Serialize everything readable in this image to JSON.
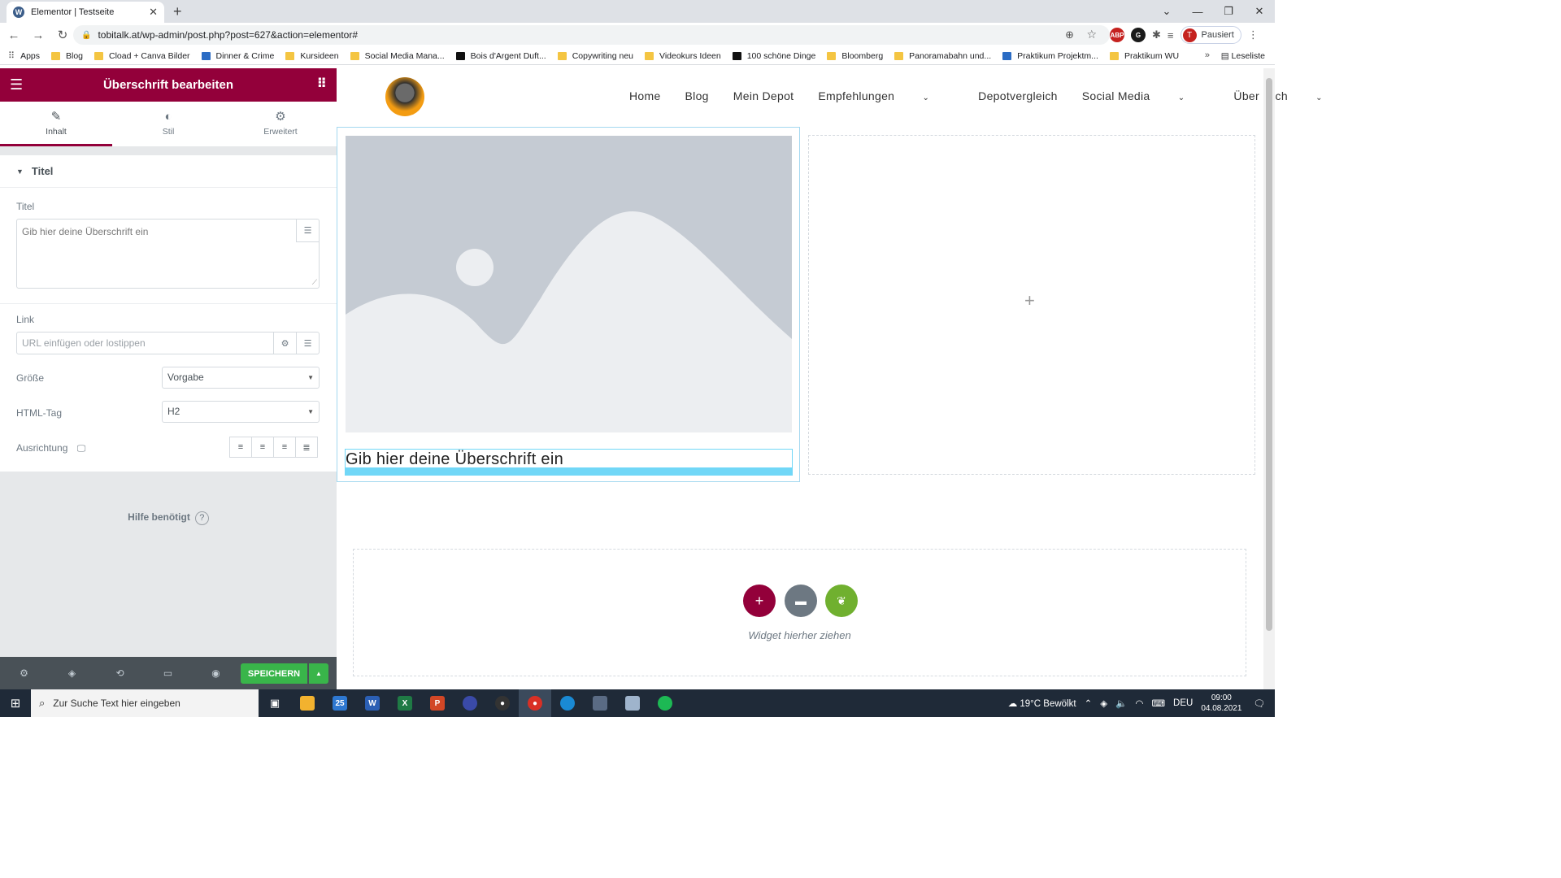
{
  "browser": {
    "tab_title": "Elementor | Testseite",
    "url": "tobitalk.at/wp-admin/post.php?post=627&action=elementor#",
    "profile_label": "Pausiert",
    "profile_initial": "T",
    "reading_list": "Leseliste",
    "bookmarks": [
      "Apps",
      "Blog",
      "Cload + Canva Bilder",
      "Dinner & Crime",
      "Kursideen",
      "Social Media Mana...",
      "Bois d'Argent Duft...",
      "Copywriting neu",
      "Videokurs Ideen",
      "100 schöne Dinge",
      "Bloomberg",
      "Panoramabahn und...",
      "Praktikum Projektm...",
      "Praktikum WU"
    ]
  },
  "panel": {
    "header_title": "Überschrift bearbeiten",
    "tabs": [
      "Inhalt",
      "Stil",
      "Erweitert"
    ],
    "section_title": "Titel",
    "title_label": "Titel",
    "title_placeholder": "Gib hier deine Überschrift ein",
    "link_label": "Link",
    "link_placeholder": "URL einfügen oder lostippen",
    "size_label": "Größe",
    "size_value": "Vorgabe",
    "html_tag_label": "HTML-Tag",
    "html_tag_value": "H2",
    "alignment_label": "Ausrichtung",
    "help_text": "Hilfe benötigt",
    "save_label": "SPEICHERN"
  },
  "site": {
    "nav": [
      "Home",
      "Blog",
      "Mein Depot",
      "Empfehlungen",
      "Depotvergleich",
      "Social Media",
      "Über mich"
    ],
    "heading_text": "Gib hier deine Überschrift ein",
    "drop_hint": "Widget hierher ziehen"
  },
  "taskbar": {
    "search_placeholder": "Zur Suche Text hier eingeben",
    "weather": "19°C  Bewölkt",
    "language": "DEU",
    "time": "09:00",
    "date": "04.08.2021",
    "mail_badge": "25"
  },
  "colors": {
    "elementor_brand": "#93003a",
    "save_green": "#39b54a",
    "selection_blue": "#71d7f7"
  }
}
